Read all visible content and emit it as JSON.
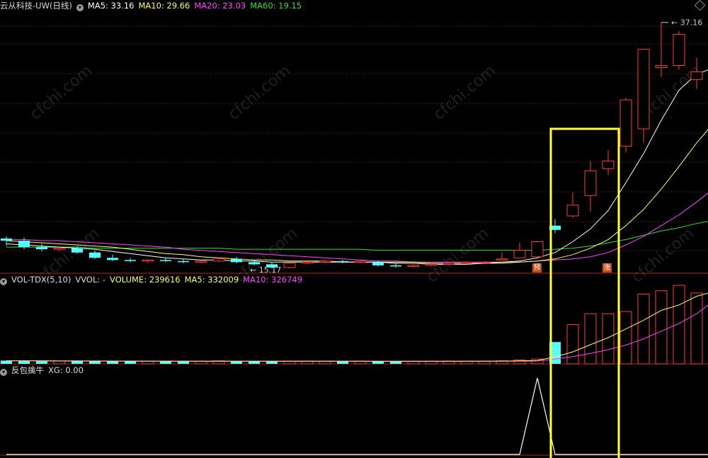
{
  "colors": {
    "bg": "#000000",
    "up": "#ff3b3b",
    "down": "#54ffff",
    "grid": "#8b1a1a",
    "ma5": "#ffffff",
    "ma10": "#ffff66",
    "ma20": "#ff44ff",
    "ma60": "#33dd33",
    "highlight": "#ffff33"
  },
  "price_panel": {
    "stock": "云从科技-UW(日线)",
    "ma5_label": "MA5: 33.16",
    "ma10_label": "MA10: 29.66",
    "ma20_label": "MA20: 23.03",
    "ma60_label": "MA60: 19.15",
    "high_label": "37.16",
    "low_label": "15.17",
    "tag_pre": "预",
    "tag_up": "涨"
  },
  "volume_panel": {
    "title": "VOL-TDX(5,10)",
    "vvol": "VVOL: -",
    "volume": "VOLUME: 239616",
    "ma5": "MA5: 332009",
    "ma10": "MA10: 326749"
  },
  "indicator_panel": {
    "title": "反包擒牛",
    "xg": "XG: 0.00"
  },
  "watermark": "cfchi.com",
  "chart_data": {
    "type": "candlestick",
    "candles": [
      [
        17.1,
        17.3,
        16.4,
        16.9
      ],
      [
        16.9,
        17.2,
        16.1,
        16.3
      ],
      [
        16.3,
        16.6,
        15.9,
        16.1
      ],
      [
        16.1,
        16.4,
        15.9,
        16.2
      ],
      [
        16.2,
        16.4,
        15.7,
        15.8
      ],
      [
        15.8,
        16.0,
        15.2,
        15.3
      ],
      [
        15.3,
        15.6,
        15.0,
        15.1
      ],
      [
        15.1,
        15.3,
        14.9,
        15.0
      ],
      [
        15.0,
        15.2,
        14.8,
        15.1
      ],
      [
        15.1,
        15.3,
        14.9,
        15.0
      ],
      [
        15.0,
        15.2,
        14.8,
        14.9
      ],
      [
        14.9,
        15.1,
        14.8,
        15.0
      ],
      [
        15.0,
        15.3,
        14.9,
        15.2
      ],
      [
        15.2,
        15.4,
        14.8,
        14.9
      ],
      [
        14.9,
        15.1,
        14.6,
        14.7
      ],
      [
        14.7,
        14.9,
        14.3,
        14.4
      ],
      [
        14.4,
        14.9,
        14.3,
        14.8
      ],
      [
        14.8,
        15.1,
        14.7,
        14.9
      ],
      [
        14.9,
        15.1,
        14.8,
        15.0
      ],
      [
        15.0,
        15.1,
        14.8,
        14.9
      ],
      [
        14.9,
        15.1,
        14.8,
        15.0
      ],
      [
        14.9,
        15.0,
        14.5,
        14.6
      ],
      [
        14.6,
        14.8,
        14.4,
        14.5
      ],
      [
        14.5,
        14.7,
        14.4,
        14.6
      ],
      [
        14.6,
        14.8,
        14.5,
        14.7
      ],
      [
        14.7,
        14.9,
        14.6,
        14.8
      ],
      [
        14.8,
        15.0,
        14.7,
        14.9
      ],
      [
        14.9,
        15.0,
        14.8,
        14.9
      ],
      [
        15.1,
        15.8,
        15.1,
        15.2
      ],
      [
        15.3,
        16.7,
        15.3,
        16.0
      ],
      [
        15.4,
        16.9,
        15.4,
        16.8
      ],
      [
        18.3,
        18.9,
        17.6,
        17.9
      ],
      [
        19.2,
        21.4,
        19.0,
        20.2
      ],
      [
        21.1,
        24.3,
        19.6,
        23.4
      ],
      [
        23.6,
        25.3,
        23.0,
        24.3
      ],
      [
        25.7,
        30.2,
        25.1,
        30.0
      ],
      [
        27.3,
        32.7,
        26.0,
        34.7
      ],
      [
        33.0,
        37.2,
        32.1,
        33.2
      ],
      [
        33.2,
        36.4,
        32.8,
        36.1
      ],
      [
        31.9,
        33.9,
        31.0,
        32.6
      ],
      [
        30.8,
        33.5,
        30.5,
        33.5
      ],
      [
        32.5,
        36.0,
        31.8,
        35.4
      ]
    ],
    "volume": [
      15000,
      14000,
      12000,
      13000,
      15000,
      13000,
      12000,
      12000,
      13000,
      12000,
      11000,
      12000,
      14000,
      12000,
      11000,
      13000,
      12000,
      13000,
      12000,
      12000,
      12000,
      11000,
      11000,
      12000,
      12000,
      13000,
      12000,
      12000,
      14000,
      18000,
      22000,
      100000,
      180000,
      230000,
      230000,
      240000,
      320000,
      335000,
      360000,
      325000,
      290000,
      240000
    ],
    "volume_ma5": [
      14000,
      14000,
      13500,
      13000,
      13000,
      12800,
      12600,
      12400,
      12300,
      12200,
      12100,
      12000,
      12000,
      12000,
      11900,
      11900,
      11900,
      12000,
      12000,
      12000,
      12000,
      11800,
      11700,
      11700,
      11700,
      11800,
      11900,
      12000,
      12500,
      13500,
      15500,
      32000,
      55000,
      88000,
      120000,
      160000,
      200000,
      245000,
      270000,
      310000,
      332000,
      332009
    ],
    "volume_ma10": [
      14000,
      14000,
      13800,
      13600,
      13500,
      13300,
      13100,
      12900,
      12800,
      12600,
      12500,
      12400,
      12300,
      12200,
      12100,
      12000,
      12000,
      12000,
      12000,
      12000,
      12000,
      11900,
      11900,
      11900,
      11900,
      11900,
      11900,
      11900,
      12100,
      12400,
      13000,
      22000,
      33000,
      48000,
      65000,
      86000,
      115000,
      150000,
      185000,
      230000,
      290000,
      326749
    ],
    "ma5": [
      16.6,
      16.5,
      16.4,
      16.3,
      16.2,
      16.1,
      15.9,
      15.7,
      15.5,
      15.3,
      15.2,
      15.1,
      15.1,
      15.0,
      15.0,
      14.9,
      14.9,
      14.9,
      14.9,
      14.9,
      14.9,
      14.9,
      14.8,
      14.8,
      14.7,
      14.7,
      14.7,
      14.8,
      14.9,
      15.0,
      15.3,
      15.8,
      16.8,
      18.0,
      19.7,
      22.3,
      25.0,
      28.1,
      30.9,
      32.4,
      33.0,
      33.16
    ],
    "ma10": [
      16.9,
      16.8,
      16.7,
      16.6,
      16.5,
      16.4,
      16.3,
      16.1,
      15.9,
      15.7,
      15.6,
      15.4,
      15.3,
      15.2,
      15.1,
      15.1,
      15.0,
      15.0,
      15.0,
      14.9,
      14.9,
      14.9,
      14.9,
      14.9,
      14.8,
      14.8,
      14.8,
      14.8,
      14.8,
      14.9,
      15.0,
      15.2,
      15.6,
      16.2,
      17.0,
      18.3,
      19.8,
      21.7,
      23.8,
      26.0,
      27.9,
      29.66
    ],
    "ma20": [
      17.0,
      17.0,
      16.9,
      16.9,
      16.8,
      16.7,
      16.6,
      16.5,
      16.4,
      16.3,
      16.1,
      16.0,
      15.9,
      15.8,
      15.7,
      15.6,
      15.5,
      15.4,
      15.3,
      15.2,
      15.1,
      15.0,
      15.0,
      14.9,
      14.9,
      14.9,
      14.9,
      14.9,
      14.9,
      14.9,
      15.0,
      15.1,
      15.2,
      15.4,
      15.8,
      16.5,
      17.3,
      18.3,
      19.3,
      20.5,
      21.8,
      23.03
    ],
    "ma60": [
      16.3,
      16.3,
      16.3,
      16.3,
      16.3,
      16.2,
      16.2,
      16.2,
      16.2,
      16.2,
      16.2,
      16.2,
      16.2,
      16.1,
      16.1,
      16.1,
      16.1,
      16.1,
      16.1,
      16.1,
      16.1,
      16.0,
      16.0,
      16.0,
      16.0,
      16.0,
      16.0,
      16.0,
      16.0,
      16.0,
      16.0,
      16.1,
      16.2,
      16.4,
      16.7,
      17.0,
      17.4,
      17.8,
      18.1,
      18.5,
      18.8,
      19.15
    ],
    "xg": [
      0,
      0,
      0,
      0,
      0,
      0,
      0,
      0,
      0,
      0,
      0,
      0,
      0,
      0,
      0,
      0,
      0,
      0,
      0,
      0,
      0,
      0,
      0,
      0,
      0,
      0,
      0,
      0,
      0,
      0,
      1,
      0,
      0,
      0,
      0,
      0,
      0,
      0,
      0,
      0,
      0,
      0
    ],
    "high_index": 37,
    "low_index": 14,
    "signal_index": 31,
    "ylim": [
      14,
      38.5
    ]
  }
}
